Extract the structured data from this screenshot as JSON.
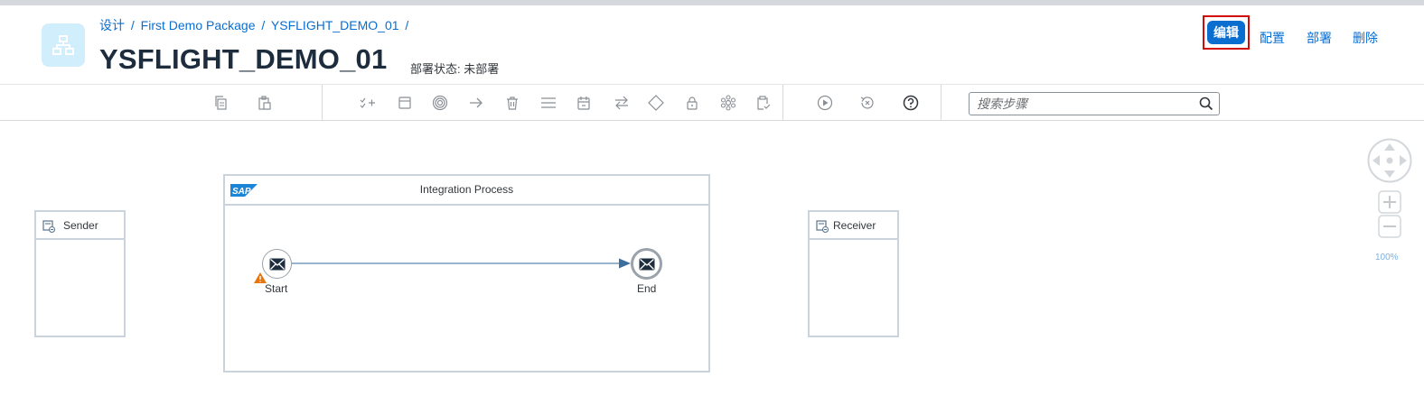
{
  "breadcrumb": {
    "items": [
      "设计",
      "First Demo Package",
      "YSFLIGHT_DEMO_01"
    ],
    "separator": "/"
  },
  "header": {
    "title": "YSFLIGHT_DEMO_01",
    "status": "部署状态: 未部署"
  },
  "actions": {
    "edit": "编辑",
    "configure": "配置",
    "deploy": "部署",
    "delete": "删除"
  },
  "search": {
    "placeholder": "搜索步骤"
  },
  "toolbar": {
    "icons": [
      "copy-icon",
      "paste-icon",
      "check-add-icon",
      "panel-icon",
      "target-icon",
      "arrow-right-icon",
      "trash-icon",
      "menu-icon",
      "calendar-icon",
      "swap-icon",
      "diamond-icon",
      "lock-icon",
      "cube-icon",
      "clipboard-check-icon",
      "play-icon",
      "undo-icon",
      "help-icon"
    ]
  },
  "diagram": {
    "sender": "Sender",
    "receiver": "Receiver",
    "process_title": "Integration Process",
    "start_label": "Start",
    "end_label": "End",
    "sap_logo_text": "SAP"
  },
  "zoom": {
    "level": "100%"
  },
  "colors": {
    "accent": "#0a6ed1",
    "highlight_border": "#d20a0a",
    "pool_border": "#cbd3dc",
    "warning": "#e9730c"
  }
}
